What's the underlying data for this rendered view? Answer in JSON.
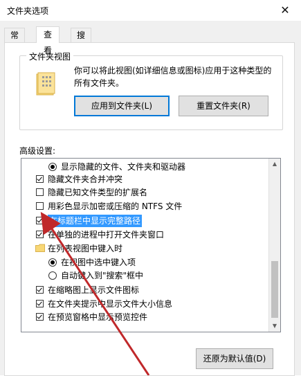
{
  "window": {
    "title": "文件夹选项",
    "close_glyph": "✕"
  },
  "tabs": [
    {
      "label": "常规",
      "active": false
    },
    {
      "label": "查看",
      "active": true
    },
    {
      "label": "搜索",
      "active": false
    }
  ],
  "folder_views": {
    "group_title": "文件夹视图",
    "description": "你可以将此视图(如详细信息或图标)应用于这种类型的所有文件夹。",
    "apply_button": "应用到文件夹(L)",
    "reset_button": "重置文件夹(R)"
  },
  "advanced": {
    "label": "高级设置:",
    "items": [
      {
        "text": "显示隐藏的文件、文件夹和驱动器",
        "kind": "radio",
        "checked": true,
        "indent": 1
      },
      {
        "text": "隐藏文件夹合并冲突",
        "kind": "checkbox",
        "checked": true,
        "indent": 0
      },
      {
        "text": "隐藏已知文件类型的扩展名",
        "kind": "checkbox",
        "checked": false,
        "indent": 0
      },
      {
        "text": "用彩色显示加密或压缩的 NTFS 文件",
        "kind": "checkbox",
        "checked": false,
        "indent": 0
      },
      {
        "text": "在标题栏中显示完整路径",
        "kind": "checkbox",
        "checked": true,
        "indent": 0,
        "selected": true
      },
      {
        "text": "在单独的进程中打开文件夹窗口",
        "kind": "checkbox",
        "checked": true,
        "indent": 0
      },
      {
        "text": "在列表视图中键入时",
        "kind": "folder",
        "checked": false,
        "indent": 0
      },
      {
        "text": "在视图中选中键入项",
        "kind": "radio",
        "checked": true,
        "indent": 1
      },
      {
        "text": "自动键入到\"搜索\"框中",
        "kind": "radio",
        "checked": false,
        "indent": 1
      },
      {
        "text": "在缩略图上显示文件图标",
        "kind": "checkbox",
        "checked": true,
        "indent": 0
      },
      {
        "text": "在文件夹提示中显示文件大小信息",
        "kind": "checkbox",
        "checked": true,
        "indent": 0
      },
      {
        "text": "在预览窗格中显示预览控件",
        "kind": "checkbox",
        "checked": true,
        "indent": 0
      }
    ],
    "restore_button": "还原为默认值(D)"
  },
  "icons": {
    "close": "close-icon",
    "folder": "folder-icon",
    "scroll_up": "▲",
    "scroll_down": "▼"
  },
  "colors": {
    "selection": "#3399ff",
    "arrow": "#c0282a",
    "accent_border": "#0078d7"
  }
}
